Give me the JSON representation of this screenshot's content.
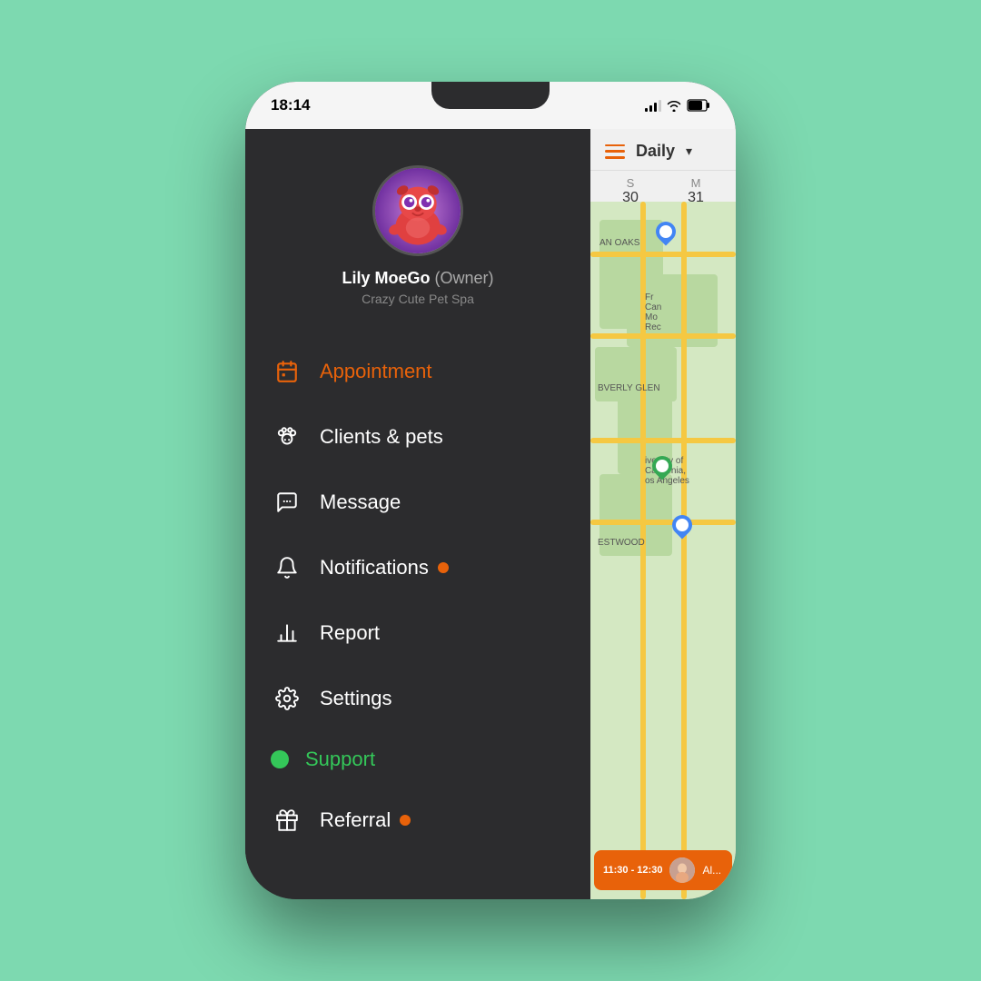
{
  "background": "#7dd9b0",
  "phone": {
    "status_bar": {
      "time": "18:14",
      "battery": "74"
    },
    "sidebar": {
      "user": {
        "name": "Lily MoeGo",
        "owner_label": "(Owner)",
        "business": "Crazy Cute Pet Spa"
      },
      "nav_items": [
        {
          "id": "appointment",
          "label": "Appointment",
          "icon": "calendar",
          "active": true,
          "dot": null
        },
        {
          "id": "clients",
          "label": "Clients & pets",
          "icon": "pet",
          "active": false,
          "dot": null
        },
        {
          "id": "message",
          "label": "Message",
          "icon": "chat",
          "active": false,
          "dot": null
        },
        {
          "id": "notifications",
          "label": "Notifications",
          "icon": "bell",
          "active": false,
          "dot": "orange"
        },
        {
          "id": "report",
          "label": "Report",
          "icon": "chart",
          "active": false,
          "dot": null
        },
        {
          "id": "settings",
          "label": "Settings",
          "icon": "gear",
          "active": false,
          "dot": null
        },
        {
          "id": "support",
          "label": "Support",
          "icon": "circle-green",
          "active": false,
          "dot": null
        },
        {
          "id": "referral",
          "label": "Referral",
          "icon": "gift",
          "active": false,
          "dot": "orange"
        }
      ]
    },
    "calendar": {
      "title": "Daily",
      "days": [
        {
          "letter": "S",
          "number": "30"
        },
        {
          "letter": "M",
          "number": "31"
        }
      ]
    },
    "appointment_card": {
      "time": "11:30 - 12:30",
      "name": "Al..."
    }
  }
}
